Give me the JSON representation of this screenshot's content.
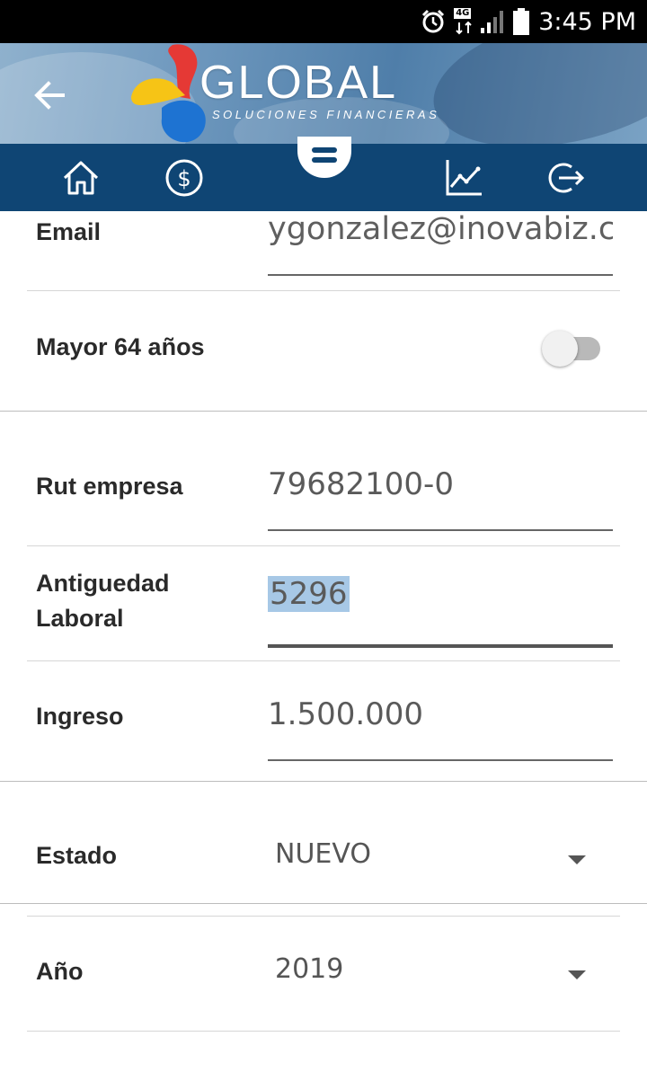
{
  "status_bar": {
    "time": "3:45 PM",
    "network": "4G",
    "icons": [
      "alarm-icon",
      "network-4g-icon",
      "signal-icon",
      "battery-icon"
    ]
  },
  "header": {
    "brand": "GLOBAL",
    "tagline": "SOLUCIONES FINANCIERAS",
    "back_icon": "arrow-left-icon",
    "colors": {
      "red": "#e53935",
      "yellow": "#f6c416",
      "blue": "#1e73d2"
    }
  },
  "nav": {
    "items": [
      {
        "icon": "home-icon"
      },
      {
        "icon": "dollar-icon"
      },
      {
        "icon": "menu-icon"
      },
      {
        "icon": "chart-icon"
      },
      {
        "icon": "logout-icon"
      }
    ],
    "background": "#0f4574"
  },
  "form": {
    "email": {
      "label": "Email",
      "value": "ygonzalez@inovabiz.c"
    },
    "mayor64": {
      "label": "Mayor 64 años",
      "checked": false
    },
    "rut": {
      "label": "Rut empresa",
      "value": "79682100-0"
    },
    "antiguedad": {
      "label_line1": "Antiguedad",
      "label_line2": "Laboral",
      "value": "5296"
    },
    "ingreso": {
      "label": "Ingreso",
      "value": "1.500.000"
    },
    "estado": {
      "label": "Estado",
      "value": "NUEVO"
    },
    "anio": {
      "label": "Año",
      "value": "2019"
    }
  }
}
